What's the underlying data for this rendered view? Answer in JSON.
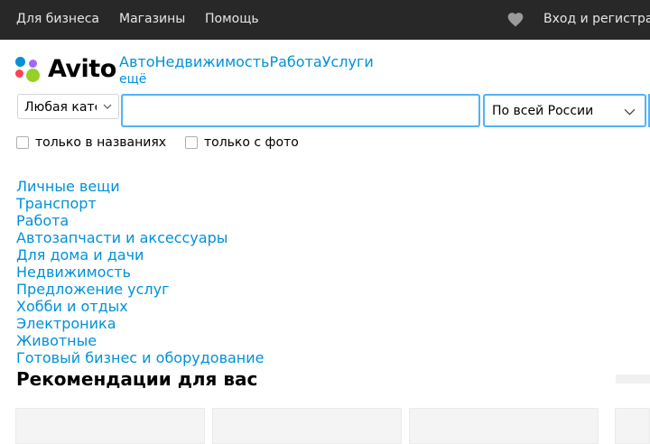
{
  "header": {
    "links": [
      "Для бизнеса",
      "Магазины",
      "Помощь"
    ],
    "login_label": "Вход и регистрация"
  },
  "logo": {
    "text": "Avito"
  },
  "nav": {
    "categories": [
      "Авто",
      "Недвижимость",
      "Работа",
      "Услуги"
    ],
    "more_label": "ещё"
  },
  "search": {
    "category_value": "Любая категория",
    "query_value": "",
    "region_value": "По всей России",
    "title_only_label": "только в названиях",
    "photo_only_label": "только с фото"
  },
  "category_list": [
    "Личные вещи",
    "Транспорт",
    "Работа",
    "Автозапчасти и аксессуары",
    "Для дома и дачи",
    "Недвижимость",
    "Предложение услуг",
    "Хобби и отдых",
    "Электроника",
    "Животные",
    "Готовый бизнес и оборудование"
  ],
  "recommendations": {
    "title": "Рекомендации для вас"
  },
  "colors": {
    "topbar": "#282828",
    "link": "#0091d9",
    "focus_border": "#4fb3f6",
    "logo_dots": [
      "#0091d9",
      "#ff4053",
      "#97cf26",
      "#a169f7"
    ]
  },
  "icons": [
    "heart-icon",
    "chevron-down-icon"
  ]
}
